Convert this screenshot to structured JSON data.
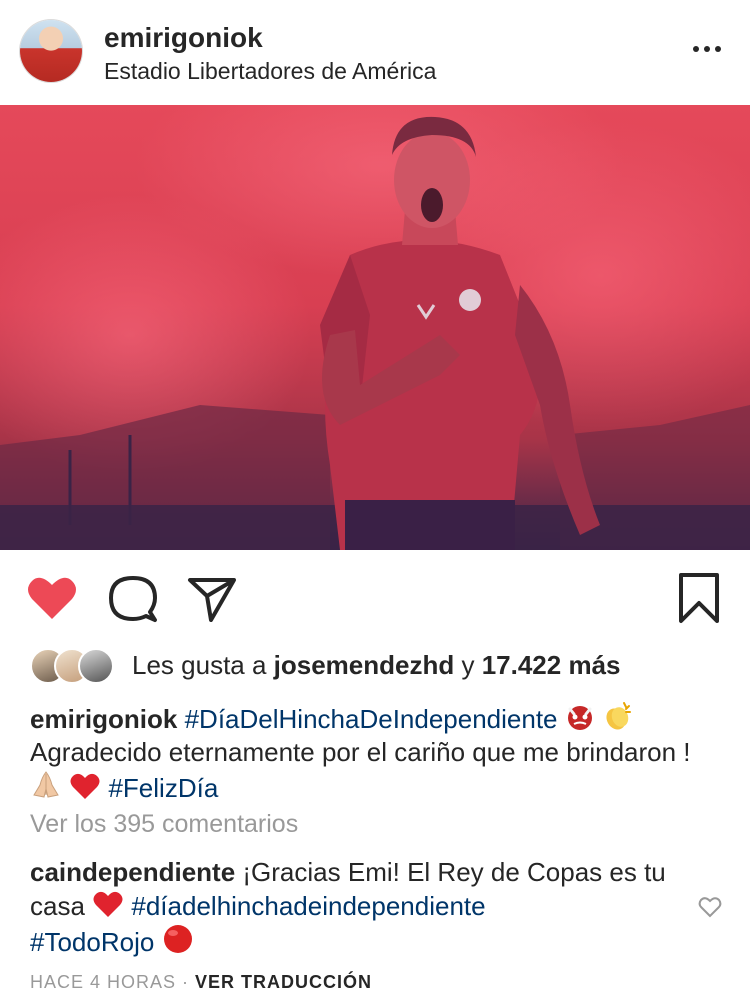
{
  "post": {
    "username": "emirigoniok",
    "location": "Estadio Libertadores de América"
  },
  "likes": {
    "prefix": "Les gusta a ",
    "user": "josemendezhd",
    "middle": " y ",
    "count": "17.422 más"
  },
  "caption": {
    "username": "emirigoniok",
    "hashtag1": "#DíaDelHinchaDeIndependiente",
    "text": "Agradecido eternamente por el cariño que me brindaron !",
    "hashtag2": "#FelizDía"
  },
  "view_comments": "Ver los 395 comentarios",
  "comment": {
    "username": "caindependiente",
    "text": "¡Gracias Emi! El Rey de Copas es tu casa",
    "hashtag1": "#díadelhinchadeindependiente",
    "hashtag2": "#TodoRojo"
  },
  "footer": {
    "time": "HACE 4 HORAS",
    "separator": " · ",
    "translate": "VER TRADUCCIÓN"
  },
  "colors": {
    "like_red": "#ed4956",
    "hashtag": "#003569",
    "muted": "#999999"
  }
}
